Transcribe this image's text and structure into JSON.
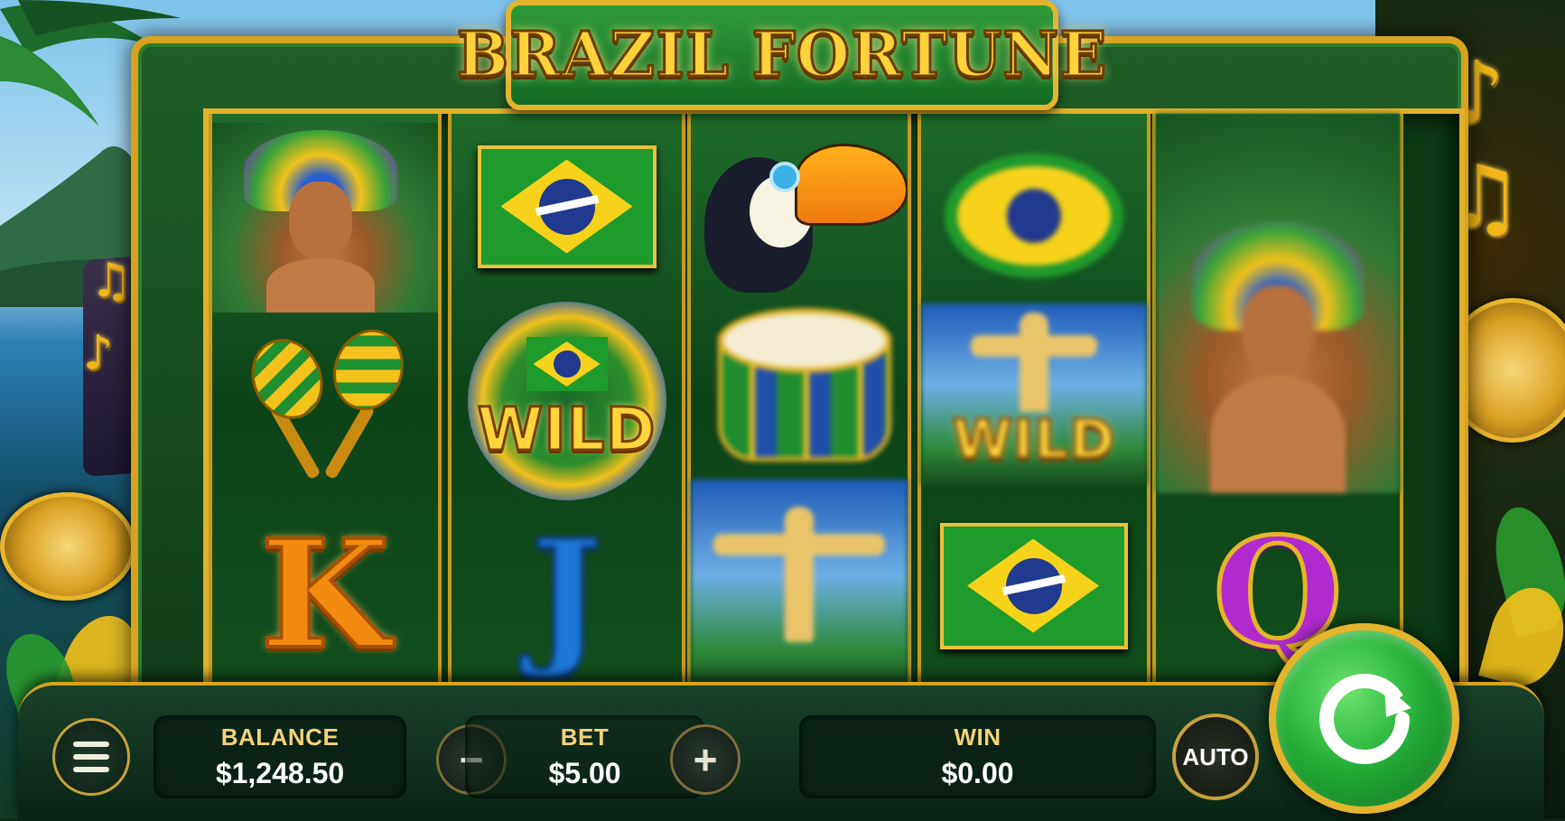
{
  "game": {
    "title": "BRAZIL FORTUNE"
  },
  "reels": [
    [
      "dancer",
      "maracas",
      "K"
    ],
    [
      "brazil-flag",
      "WILD",
      "J"
    ],
    [
      "toucan",
      "drum",
      "christ-redeemer"
    ],
    [
      "brazil-flag",
      "WILD",
      "brazil-flag"
    ],
    [
      "dancer",
      "dancer",
      "Q"
    ]
  ],
  "symbols": {
    "letter_k": "K",
    "letter_j": "J",
    "letter_q": "Q",
    "wild_label": "WILD"
  },
  "controls": {
    "balance_label": "BALANCE",
    "balance_value": "$1,248.50",
    "bet_label": "BET",
    "bet_value": "$5.00",
    "bet_decrease": "−",
    "bet_increase": "+",
    "win_label": "WIN",
    "win_value": "$0.00",
    "auto_label": "AUTO",
    "menu_icon": "hamburger-menu-icon",
    "spin_icon": "spin-refresh-icon"
  },
  "colors": {
    "frame_gold": "#d6a21f",
    "spin_green": "#27b13a",
    "title_gold": "#ffd23b"
  }
}
